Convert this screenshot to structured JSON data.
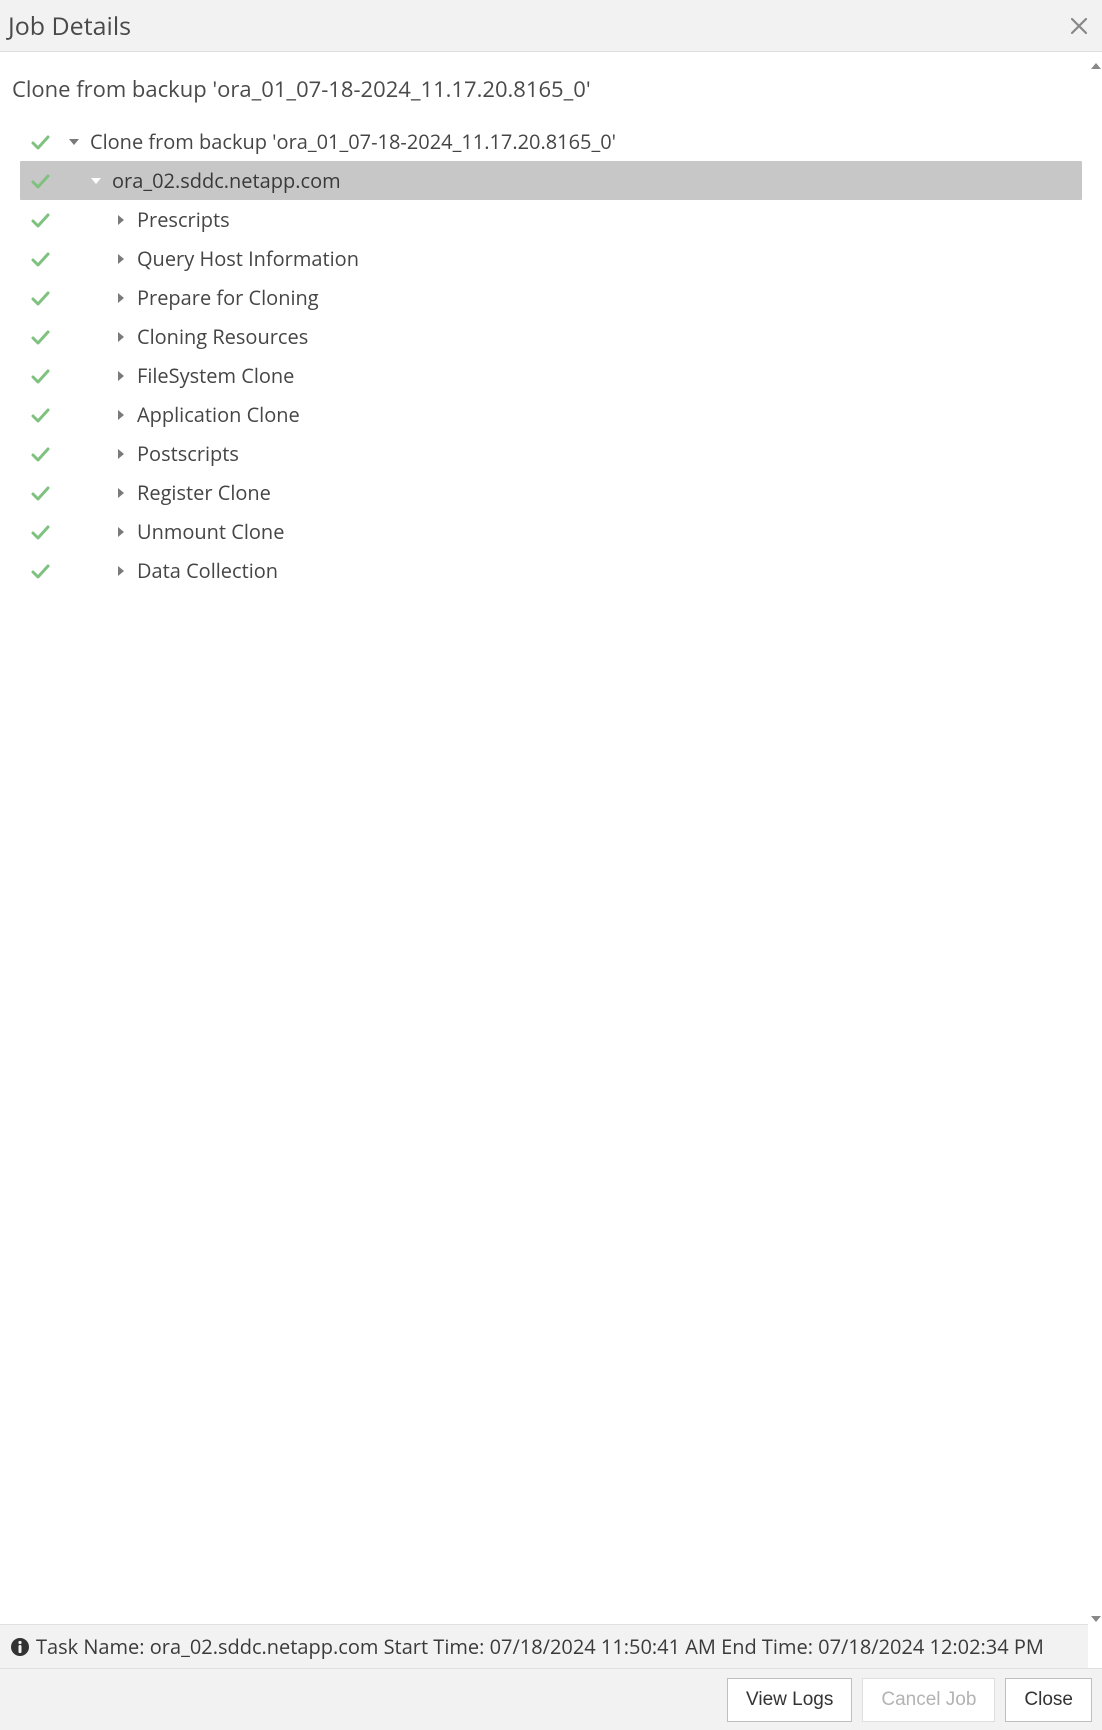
{
  "header": {
    "title": "Job Details"
  },
  "subheader": "Clone from backup 'ora_01_07-18-2024_11.17.20.8165_0'",
  "tree": [
    {
      "label": "Clone from backup 'ora_01_07-18-2024_11.17.20.8165_0'",
      "depth": 0,
      "expanded": true,
      "selected": false
    },
    {
      "label": "ora_02.sddc.netapp.com",
      "depth": 1,
      "expanded": true,
      "selected": true
    },
    {
      "label": "Prescripts",
      "depth": 2,
      "expanded": false,
      "selected": false
    },
    {
      "label": "Query Host Information",
      "depth": 2,
      "expanded": false,
      "selected": false
    },
    {
      "label": "Prepare for Cloning",
      "depth": 2,
      "expanded": false,
      "selected": false
    },
    {
      "label": "Cloning Resources",
      "depth": 2,
      "expanded": false,
      "selected": false
    },
    {
      "label": "FileSystem Clone",
      "depth": 2,
      "expanded": false,
      "selected": false
    },
    {
      "label": "Application Clone",
      "depth": 2,
      "expanded": false,
      "selected": false
    },
    {
      "label": "Postscripts",
      "depth": 2,
      "expanded": false,
      "selected": false
    },
    {
      "label": "Register Clone",
      "depth": 2,
      "expanded": false,
      "selected": false
    },
    {
      "label": "Unmount Clone",
      "depth": 2,
      "expanded": false,
      "selected": false
    },
    {
      "label": "Data Collection",
      "depth": 2,
      "expanded": false,
      "selected": false
    }
  ],
  "status": {
    "task_name_label": "Task Name:",
    "task_name": "ora_02.sddc.netapp.com",
    "start_label": "Start Time:",
    "start_time": "07/18/2024 11:50:41 AM",
    "end_label": "End Time:",
    "end_time": "07/18/2024 12:02:34 PM"
  },
  "footer": {
    "view_logs": "View Logs",
    "cancel_job": "Cancel Job",
    "close": "Close"
  }
}
